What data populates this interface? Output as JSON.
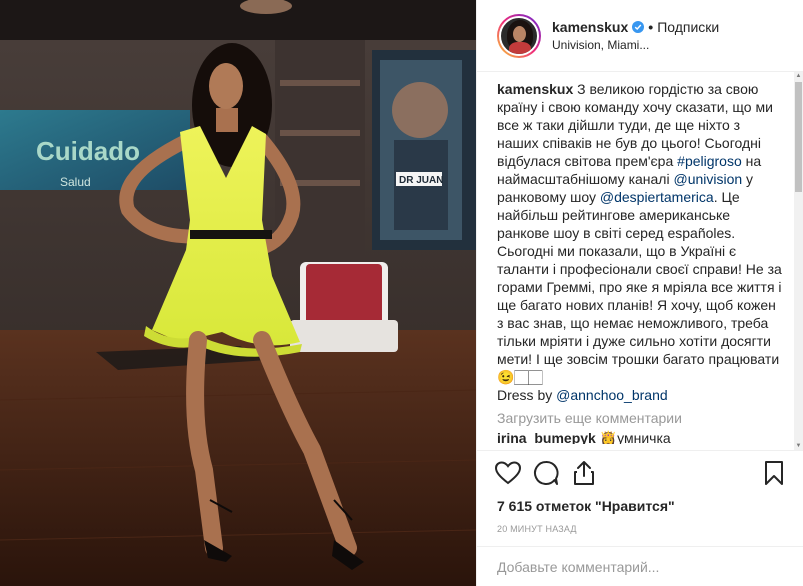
{
  "header": {
    "username": "kamenskux",
    "separator": "•",
    "follow_label": "Подписки",
    "location": "Univision, Miami..."
  },
  "photo": {
    "bg_sign": "Cuidado",
    "bg_sign_sub": "Salud",
    "bg_poster": "DR JUAN"
  },
  "caption": {
    "username": "kamenskux",
    "text_1": " З великою гордістю за свою країну і свою команду хочу сказати, що ми все ж таки дійшли туди, де ще ніхто з наших співаків не був до цього! Сьогодні відбулася світова прем'єра ",
    "hashtag": "#peligroso",
    "text_2": " на наймасштабнішому каналі ",
    "mention_1": "@univision",
    "text_3": " у ранковому шоу ",
    "mention_2": "@despiertamerica",
    "text_4": ". Це найбільш рейтингове американське ранкове шоу в світі серед españoles. Сьогодні ми показали, що в Україні є таланти і професіонали своєї справи! Не за горами Греммі, про яке я мріяла все життя і ще багато нових планів! Я хочу, щоб кожен з вас знав, що немає неможливого, треба тільки мріяти і дуже сильно хотіти досягти мети! І ще зовсім трошки багато працювати 😉🏻🏻",
    "dress_text": "Dress by ",
    "mention_3": "@annchoo_brand"
  },
  "load_more_label": "Загрузить еще комментарии",
  "next_comment": {
    "username": "irina_bumepyk",
    "text": " 👸умничка"
  },
  "likes_text": "7 615 отметок \"Нравится\"",
  "timestamp": "20 МИНУТ НАЗАД",
  "comment_input": {
    "placeholder": "Добавьте комментарий..."
  },
  "icons": {
    "like": "heart-icon",
    "comment": "comment-icon",
    "share": "share-icon",
    "save": "bookmark-icon",
    "verified": "verified-badge-icon"
  },
  "colors": {
    "verified_blue": "#3897f0",
    "link_blue": "#003569",
    "muted_gray": "#999999",
    "dress_yellow": "#e6f04a"
  }
}
